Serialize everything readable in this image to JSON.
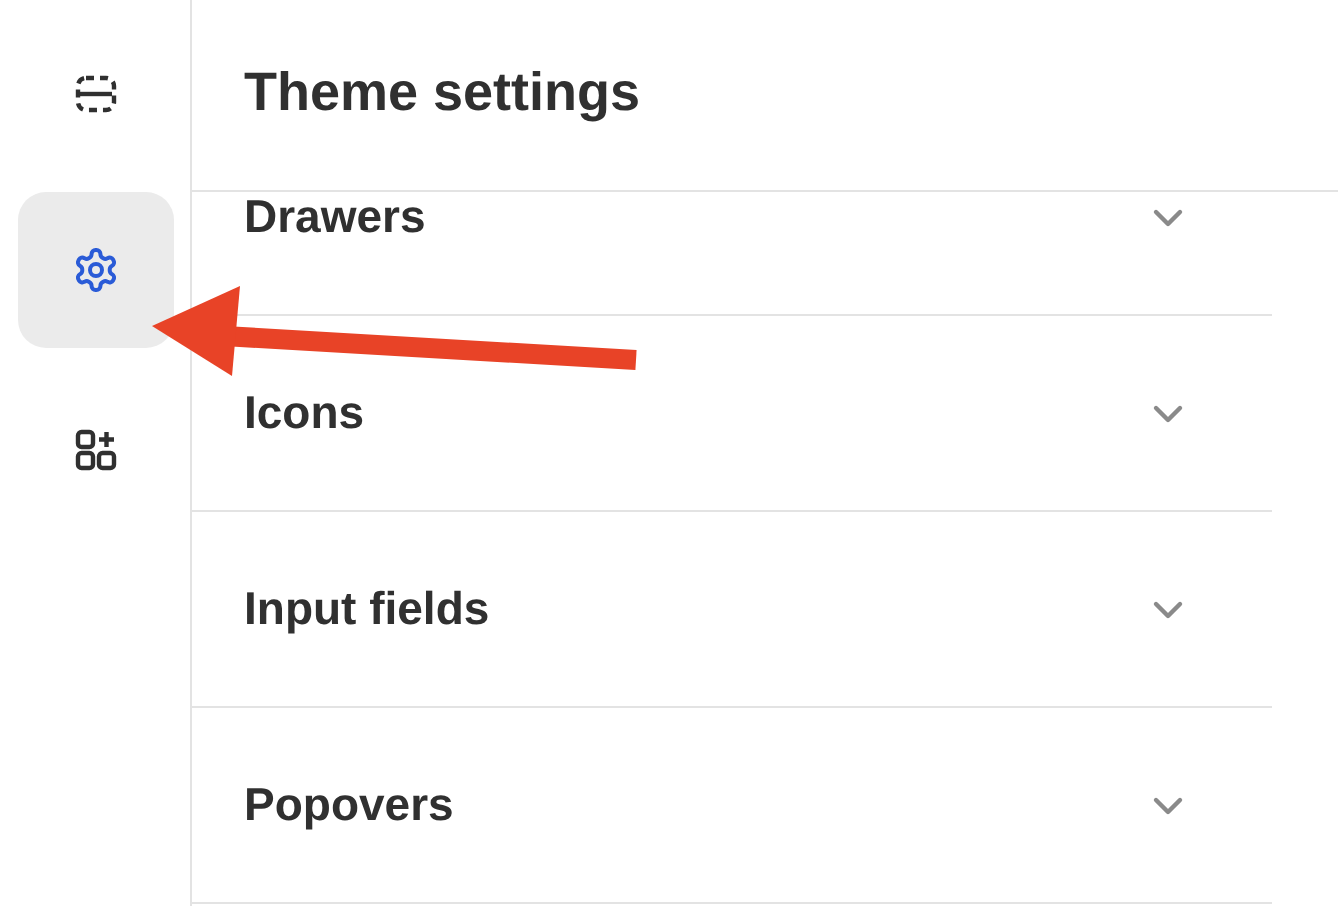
{
  "sidebar": {
    "items": [
      {
        "kind": "layout",
        "selected": false
      },
      {
        "kind": "settings",
        "selected": true
      },
      {
        "kind": "apps",
        "selected": false
      }
    ]
  },
  "header": {
    "title": "Theme settings"
  },
  "sections": [
    {
      "label": "Drawers",
      "expanded": false
    },
    {
      "label": "Icons",
      "expanded": false
    },
    {
      "label": "Input fields",
      "expanded": false
    },
    {
      "label": "Popovers",
      "expanded": false
    }
  ]
}
